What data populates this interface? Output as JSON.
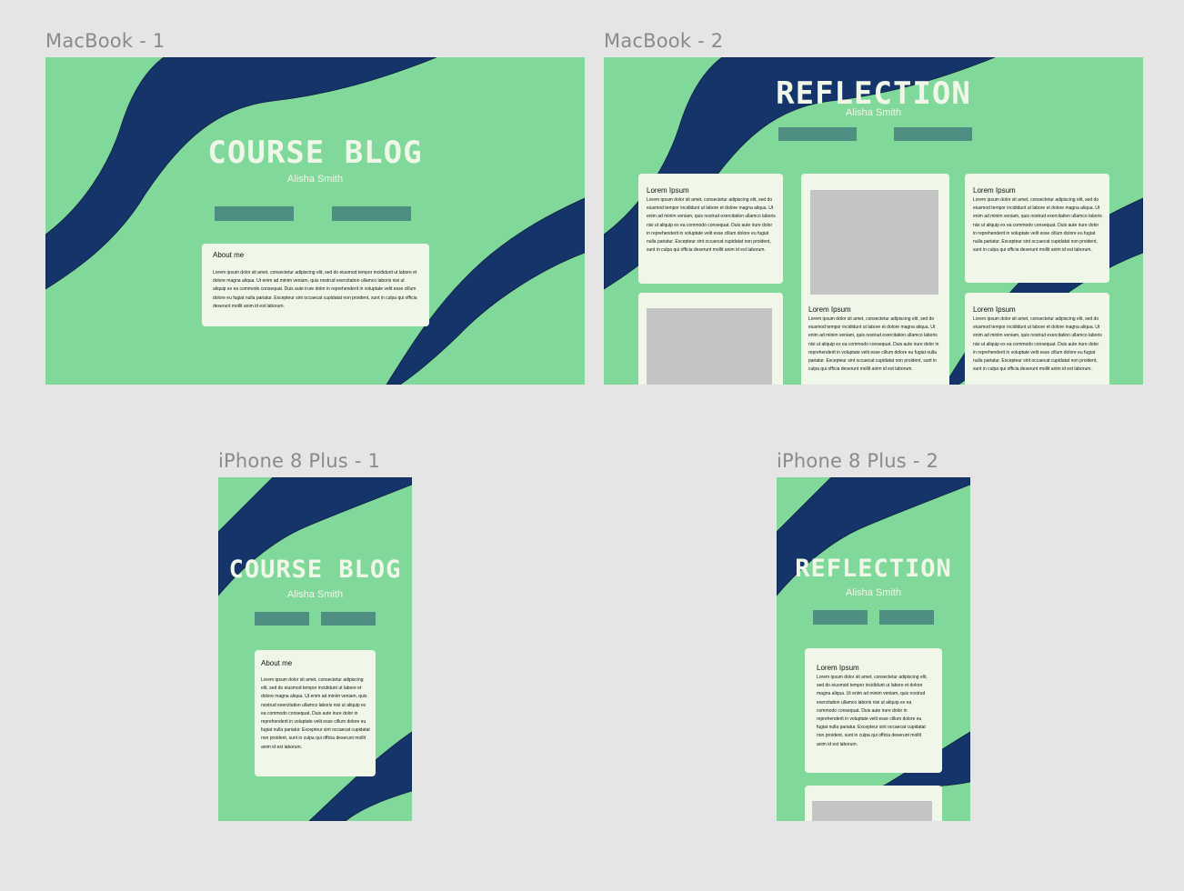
{
  "artboards": {
    "macbook1": {
      "label": "MacBook - 1",
      "title": "COURSE BLOG",
      "author": "Alisha Smith",
      "card": {
        "heading": "About me",
        "body": "Lorem ipsum dolor sit amet, consectetur adipiscing elit, sed do eiusmod tempor incididunt ut labore et dolore magna aliqua. Ut enim ad minim veniam, quis nostrud exercitation ullamco laboris nisi ut aliquip ex ea commodo consequat. Duis aute irure dolor in reprehenderit in voluptate velit esse cillum dolore eu fugiat nulla pariatur. Excepteur sint occaecat cupidatat non proident, sunt in culpa qui officia deserunt mollit anim id est laborum."
      }
    },
    "macbook2": {
      "label": "MacBook - 2",
      "title": "REFLECTION",
      "author": "Alisha Smith",
      "cards": [
        {
          "heading": "Lorem Ipsum",
          "body": "Lorem ipsum dolor sit amet, consectetur adipiscing elit, sed do eiusmod tempor incididunt ut labore et dolore magna aliqua. Ut enim ad minim veniam, quis nostrud exercitation ullamco laboris nisi ut aliquip ex ea commodo consequat. Duis aute irure dolor in reprehenderit in voluptate velit esse cillum dolore eu fugiat nulla pariatur. Excepteur sint occaecat cupidatat non proident, sunt in culpa qui officia deserunt mollit anim id est laborum."
        },
        {
          "heading": "Lorem Ipsum",
          "body": "Lorem ipsum dolor sit amet, consectetur adipiscing elit, sed do eiusmod tempor incididunt ut labore et dolore magna aliqua. Ut enim ad minim veniam, quis nostrud exercitation ullamco laboris nisi ut aliquip ex ea commodo consequat. Duis aute irure dolor in reprehenderit in voluptate velit esse cillum dolore eu fugiat nulla pariatur. Excepteur sint occaecat cupidatat non proident, sunt in culpa qui officia deserunt mollit anim id est laborum."
        },
        {
          "heading": "Lorem Ipsum",
          "body": "Lorem ipsum dolor sit amet, consectetur adipiscing elit, sed do eiusmod tempor incididunt ut labore et dolore magna aliqua. Ut enim ad minim veniam, quis nostrud exercitation ullamco laboris nisi ut aliquip ex ea commodo consequat. Duis aute irure dolor in reprehenderit in voluptate velit esse cillum dolore eu fugiat nulla pariatur. Excepteur sint occaecat cupidatat non proident, sunt in culpa qui officia deserunt mollit anim id est laborum."
        },
        {
          "heading": "Lorem Ipsum",
          "body": "Lorem ipsum dolor sit amet, consectetur adipiscing elit, sed do eiusmod tempor incididunt ut labore et dolore magna aliqua. Ut enim ad minim veniam, quis nostrud exercitation ullamco laboris nisi ut aliquip ex ea commodo consequat. Duis aute irure dolor in reprehenderit in voluptate velit esse cillum dolore eu fugiat nulla pariatur. Excepteur sint occaecat cupidatat non proident, sunt in culpa qui officia deserunt mollit anim id est laborum."
        }
      ]
    },
    "iphone1": {
      "label": "iPhone 8 Plus - 1",
      "title": "COURSE BLOG",
      "author": "Alisha Smith",
      "card": {
        "heading": "About me",
        "body": "Lorem ipsum dolor sit amet, consectetur adipiscing elit, sed do eiusmod tempor incididunt ut labore et dolore magna aliqua. Ut enim ad minim veniam, quis nostrud exercitation ullamco laboris nisi ut aliquip ex ea commodo consequat. Duis aute irure dolor in reprehenderit in voluptate velit esse cillum dolore eu fugiat nulla pariatur. Excepteur sint occaecat cupidatat non proident, sunt in culpa qui officia deserunt mollit anim id est laborum."
      }
    },
    "iphone2": {
      "label": "iPhone 8 Plus - 2",
      "title": "REFLECTION",
      "author": "Alisha Smith",
      "card": {
        "heading": "Lorem Ipsum",
        "body": "Lorem ipsum dolor sit amet, consectetur adipiscing elit, sed do eiusmod tempor incididunt ut labore et dolore magna aliqua. Ut enim ad minim veniam, quis nostrud exercitation ullamco laboris nisi ut aliquip ex ea commodo consequat. Duis aute irure dolor in reprehenderit in voluptate velit esse cillum dolore eu fugiat nulla pariatur. Excepteur sint occaecat cupidatat non proident, sunt in culpa qui officia deserunt mollit anim id est laborum."
      }
    }
  },
  "colors": {
    "canvas": "#e5e5e5",
    "artboard_green": "#80d99b",
    "wave_navy": "#15356a",
    "card_cream": "#f1f7e8",
    "button_teal": "#4e8f82",
    "image_placeholder": "#c4c4c4"
  }
}
